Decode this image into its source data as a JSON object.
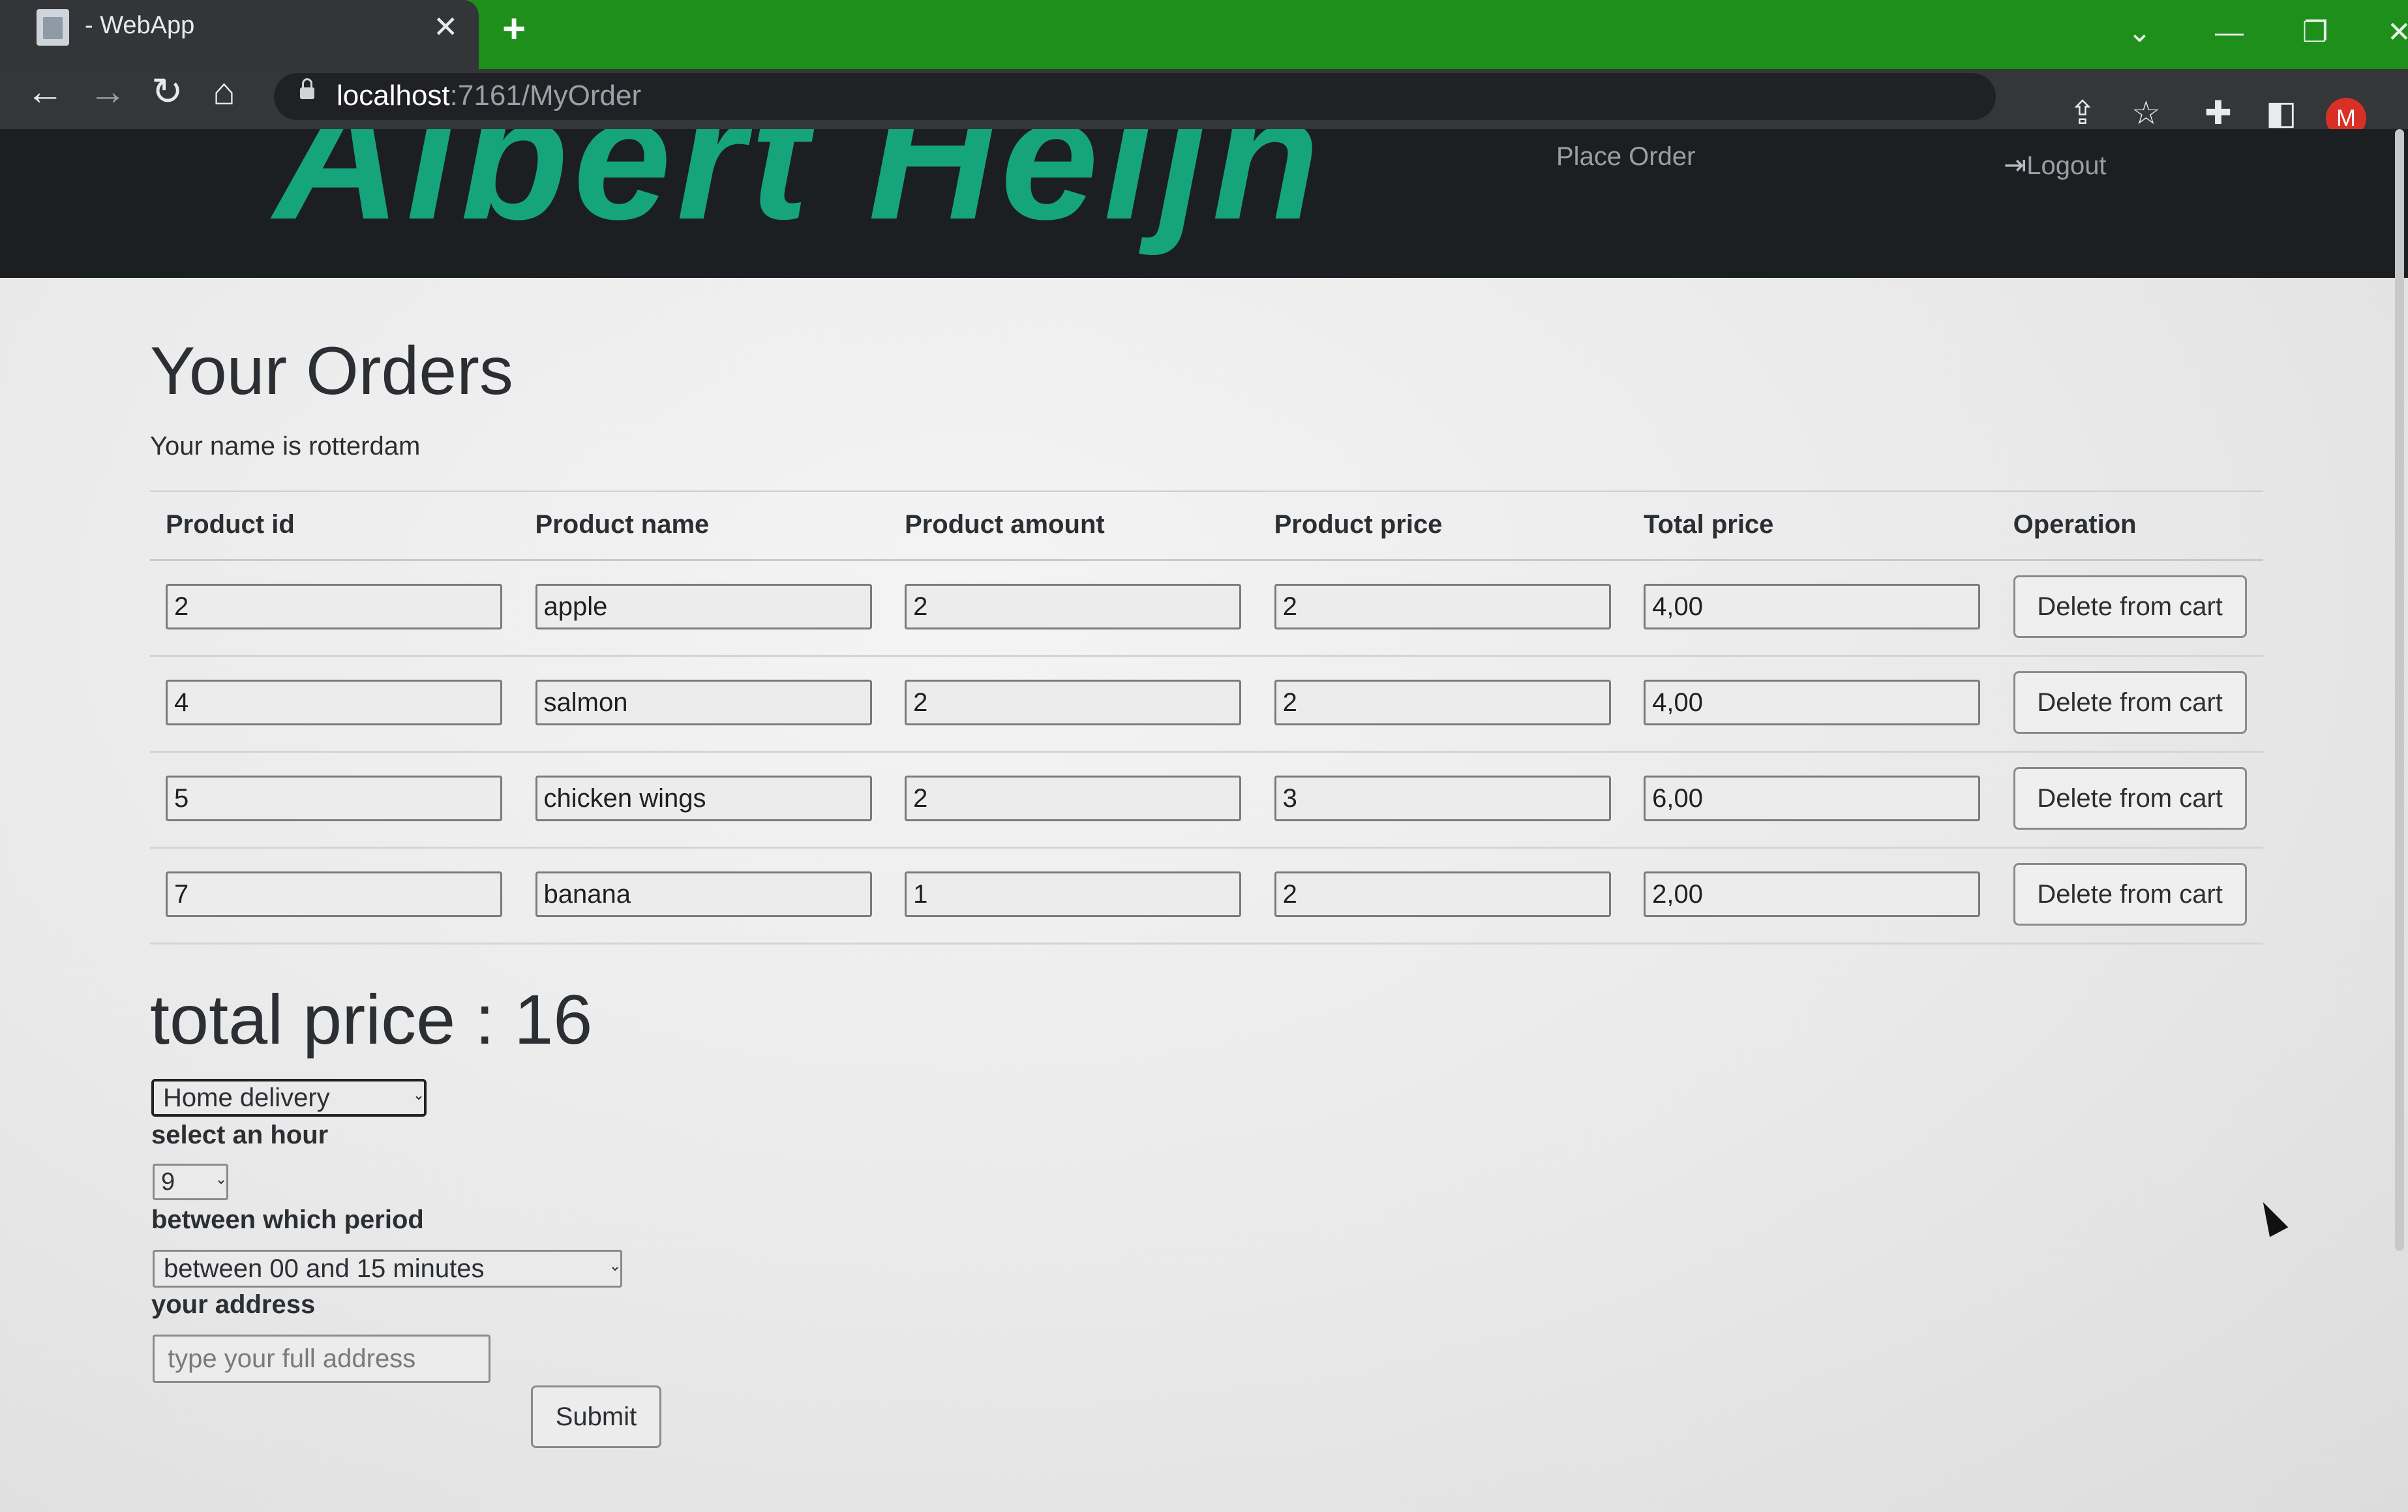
{
  "browser": {
    "tab_title": "- WebApp",
    "close_glyph": "✕",
    "new_tab_glyph": "+",
    "url_host": "localhost",
    "url_path": ":7161/MyOrder",
    "profile_initial": "M",
    "icons": [
      "favicon-icon",
      "back-icon",
      "forward-icon",
      "reload-icon",
      "home-icon",
      "lock-icon",
      "share-icon",
      "star-icon",
      "extensions-icon",
      "sidepanel-icon"
    ]
  },
  "navbar": {
    "brand_text": "Albert Heijn",
    "place_order": "Place Order",
    "logout": "Logout"
  },
  "main": {
    "title": "Your Orders",
    "name_line": "Your name is rotterdam",
    "columns": [
      "Product id",
      "Product name",
      "Product amount",
      "Product price",
      "Total price",
      "Operation"
    ],
    "rows": [
      {
        "id": "2",
        "name": "apple",
        "amount": "2",
        "price": "2",
        "total": "4,00",
        "op": "Delete from cart"
      },
      {
        "id": "4",
        "name": "salmon",
        "amount": "2",
        "price": "2",
        "total": "4,00",
        "op": "Delete from cart"
      },
      {
        "id": "5",
        "name": "chicken wings",
        "amount": "2",
        "price": "3",
        "total": "6,00",
        "op": "Delete from cart"
      },
      {
        "id": "7",
        "name": "banana",
        "amount": "1",
        "price": "2",
        "total": "2,00",
        "op": "Delete from cart"
      }
    ],
    "total_price": "total price : 16"
  },
  "form": {
    "delivery_selected": "Home delivery",
    "hour_label": "select an hour",
    "hour_selected": "9",
    "period_label": "between which period",
    "period_selected": "between 00 and 15 minutes",
    "address_label": "your address",
    "address_placeholder": "type your full address",
    "submit_label": "Submit"
  }
}
